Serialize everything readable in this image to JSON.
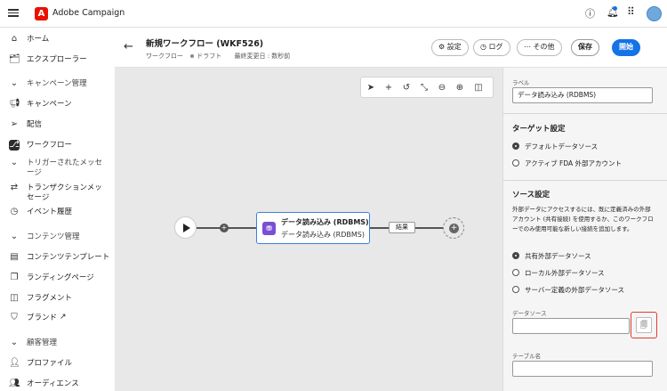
{
  "topbar": {
    "app_title": "Adobe Campaign",
    "menu_icon": "hamburger-icon",
    "help_icon": "help-icon",
    "bell_icon": "bell-icon",
    "apps_icon": "apps-grid-icon",
    "avatar_icon": "avatar"
  },
  "sidebar": {
    "home": "ホーム",
    "explorer": "エクスプローラー",
    "campaign_section": "キャンペーン管理",
    "campaign": "キャンペーン",
    "delivery": "配信",
    "workflow": "ワークフロー",
    "triggered": "トリガーされたメッセージ",
    "transactional": "トランザクションメッセージ",
    "event_history": "イベント履歴",
    "content_section": "コンテンツ管理",
    "content_template": "コンテンツテンプレート",
    "landing": "ランディングページ",
    "fragment": "フラグメント",
    "brand": "ブランド",
    "customer_section": "顧客管理",
    "profile": "プロファイル",
    "audience": "オーディエンス"
  },
  "header": {
    "title": "新規ワークフロー (WKF526)",
    "meta_type": "ワークフロー",
    "meta_status": "ドラフト",
    "meta_modified": "最終変更日 : 数秒前",
    "settings_btn": "設定",
    "log_btn": "ログ",
    "other_btn": "その他",
    "save_btn": "保存",
    "start_btn": "開始"
  },
  "canvas": {
    "node_title": "データ読み込み (RDBMS)",
    "node_subtitle": "データ読み込み (RDBMS)",
    "result_label": "結果"
  },
  "panel": {
    "label_caption": "ラベル",
    "label_value": "データ読み込み (RDBMS)",
    "target_section": "ターゲット設定",
    "target_opt1": "デフォルトデータソース",
    "target_opt2": "アクティブ FDA 外部アカウント",
    "source_section": "ソース設定",
    "source_desc": "外部データにアクセスするには、既に定義済みの外部アカウント (共有接続) を使用するか、このワークフローでのみ使用可能な新しい接続を追加します。",
    "source_opt1": "共有外部データソース",
    "source_opt2": "ローカル外部データソース",
    "source_opt3": "サーバー定義の外部データソース",
    "datasource_caption": "データソース",
    "datasource_value": "",
    "table_caption": "テーブル名",
    "table_value": ""
  }
}
